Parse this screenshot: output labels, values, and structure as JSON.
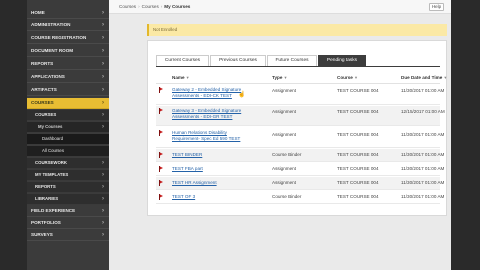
{
  "sidebar": {
    "items": [
      {
        "label": "HOME",
        "chev": "›"
      },
      {
        "label": "ADMINISTRATION",
        "chev": "›"
      },
      {
        "label": "COURSE REGISTRATION",
        "chev": "›"
      },
      {
        "label": "DOCUMENT ROOM",
        "chev": "›"
      },
      {
        "label": "REPORTS",
        "chev": "›"
      },
      {
        "label": "APPLICATIONS",
        "chev": "›"
      },
      {
        "label": "ARTIFACTS",
        "chev": "›"
      },
      {
        "label": "COURSES",
        "chev": "›"
      }
    ],
    "sub": [
      {
        "label": "COURSES",
        "chev": "›"
      },
      {
        "label": "My Courses",
        "chev": "›"
      },
      {
        "label": "Dashboard"
      },
      {
        "label": "All Courses"
      },
      {
        "label": "COURSEWORK",
        "chev": "›"
      },
      {
        "label": "MY TEMPLATES",
        "chev": "›"
      },
      {
        "label": "REPORTS",
        "chev": "›"
      },
      {
        "label": "LIBRARIES",
        "chev": "›"
      }
    ],
    "bottom": [
      {
        "label": "FIELD EXPERIENCE",
        "chev": "›"
      },
      {
        "label": "PORTFOLIOS",
        "chev": "›"
      },
      {
        "label": "SURVEYS",
        "chev": "›"
      }
    ]
  },
  "breadcrumb": {
    "c1": "Courses",
    "sep": "›",
    "c2": "Courses",
    "c3": "My Courses"
  },
  "help_label": "Help",
  "alert": {
    "text": "Not Enrolled"
  },
  "tabs": [
    "Current Courses",
    "Previous Courses",
    "Future Courses",
    "Pending tasks"
  ],
  "table": {
    "headers": {
      "name": "Name",
      "type": "Type",
      "course": "Course",
      "due": "Due Date and Time",
      "arrow": "▾"
    },
    "rows": [
      {
        "name": "Gateway 2 - Embedded Signature Assessments - EDI-CK TEST",
        "type": "Assignment",
        "course": "TEST COURSE 004",
        "due": "11/30/2017 01:00 AM"
      },
      {
        "name": "Gateway 3 - Embedded Signature Assessments - EDI-GR TEST",
        "type": "Assignment",
        "course": "TEST COURSE 004",
        "due": "12/15/2017 01:00 AM"
      },
      {
        "name": "Human Relations Disability Requirement- Spec Ed 590 TEST",
        "type": "Assignment",
        "course": "TEST COURSE 004",
        "due": "11/30/2017 01:00 AM"
      },
      {
        "name": "TEST BINDER",
        "type": "Course Binder",
        "course": "TEST COURSE 004",
        "due": "11/30/2017 01:00 AM"
      },
      {
        "name": "TEST FBA part",
        "type": "Assignment",
        "course": "TEST COURSE 004",
        "due": "11/30/2017 01:00 AM"
      },
      {
        "name": "TEST HR Assignment",
        "type": "Assignment",
        "course": "TEST COURSE 004",
        "due": "11/30/2017 01:00 AM"
      },
      {
        "name": "TEST OF 3",
        "type": "Course Binder",
        "course": "TEST COURSE 004",
        "due": "11/30/2017 01:00 AM"
      }
    ]
  },
  "colors": {
    "accent": "#e8bd33",
    "sidebar": "#3b3b3b",
    "flag": "#c31d1d",
    "link": "#2462a8"
  }
}
